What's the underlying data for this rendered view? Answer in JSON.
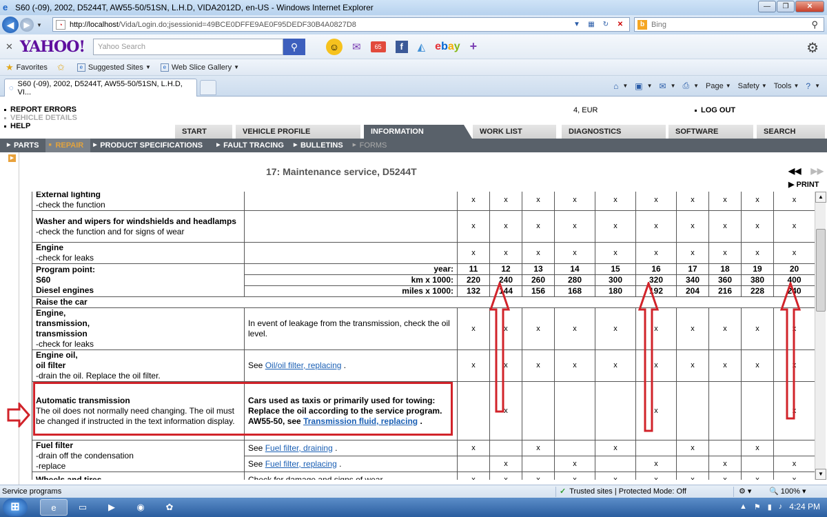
{
  "window": {
    "title": "S60 (-09), 2002, D5244T, AW55-50/51SN, L.H.D, VIDA2012D, en-US - Windows Internet Explorer"
  },
  "address": {
    "url_host": "http://localhost",
    "url_path": "/Vida/Login.do;jsessionid=49BCE0DFFE9AE0F95DEDF30B4A0827D8",
    "search_placeholder": "Bing"
  },
  "yahoo": {
    "logo": "YAHOO!",
    "search_placeholder": "Yahoo Search",
    "news_badge": "65",
    "ebay": [
      "e",
      "b",
      "a",
      "y"
    ]
  },
  "favorites": {
    "label": "Favorites",
    "items": [
      "Suggested Sites",
      "Web Slice Gallery"
    ]
  },
  "tab": {
    "label": "S60 (-09), 2002, D5244T, AW55-50/51SN, L.H.D, VI..."
  },
  "commands": [
    "Page",
    "Safety",
    "Tools"
  ],
  "app": {
    "top_menu": [
      "REPORT ERRORS",
      "VEHICLE DETAILS",
      "HELP"
    ],
    "eur": "4, EUR",
    "logout": "LOG OUT",
    "main_tabs": [
      "START",
      "VEHICLE PROFILE",
      "INFORMATION",
      "WORK LIST",
      "DIAGNOSTICS",
      "SOFTWARE",
      "SEARCH"
    ],
    "sub_tabs": [
      "PARTS",
      "REPAIR",
      "PRODUCT SPECIFICATIONS",
      "FAULT TRACING",
      "BULLETINS",
      "FORMS"
    ],
    "doc_title": "17: Maintenance service, D5244T",
    "print": "PRINT"
  },
  "table": {
    "row_exterior": {
      "title": "External lighting",
      "sub": "-check the function",
      "marks": [
        "x",
        "x",
        "x",
        "x",
        "x",
        "x",
        "x",
        "x",
        "x",
        "x"
      ]
    },
    "row_washer": {
      "title": "Washer and wipers for windshields and headlamps",
      "sub": "-check the function and for signs of wear",
      "marks": [
        "x",
        "x",
        "x",
        "x",
        "x",
        "x",
        "x",
        "x",
        "x",
        "x"
      ]
    },
    "row_engine": {
      "title": "Engine",
      "sub": "-check for leaks",
      "marks": [
        "x",
        "x",
        "x",
        "x",
        "x",
        "x",
        "x",
        "x",
        "x",
        "x"
      ]
    },
    "program": {
      "l1": "Program point:",
      "l2": "S60",
      "l3": "Diesel engines",
      "year_label": "year:",
      "km_label": "km x 1000:",
      "miles_label": "miles x 1000:",
      "years": [
        "11",
        "12",
        "13",
        "14",
        "15",
        "16",
        "17",
        "18",
        "19",
        "20"
      ],
      "km": [
        "220",
        "240",
        "260",
        "280",
        "300",
        "320",
        "340",
        "360",
        "380",
        "400"
      ],
      "miles": [
        "132",
        "144",
        "156",
        "168",
        "180",
        "192",
        "204",
        "216",
        "228",
        "240"
      ]
    },
    "raise": "Raise the car",
    "row_trans": {
      "t1": "Engine,",
      "t2": "transmission,",
      "t3": "transmission",
      "sub": "-check for leaks",
      "desc": "In event of leakage from the transmission, check the oil level.",
      "marks": [
        "x",
        "x",
        "x",
        "x",
        "x",
        "x",
        "x",
        "x",
        "x",
        "x"
      ]
    },
    "row_oil": {
      "t1": "Engine oil,",
      "t2": "oil filter",
      "sub": "-drain the oil. Replace the oil filter.",
      "see": "See",
      "link": "Oil/oil filter, replacing",
      "dot": ".",
      "marks": [
        "x",
        "x",
        "x",
        "x",
        "x",
        "x",
        "x",
        "x",
        "x",
        "x"
      ]
    },
    "row_auto": {
      "title": "Automatic transmission",
      "sub": "The oil does not normally need changing. The oil must be changed if instructed in the text information display.",
      "desc": "Cars used as taxis or primarily used for towing: Replace the oil according to the service program. AW55-50, see",
      "link": "Transmission fluid, replacing",
      "dot": ".",
      "marks": [
        "",
        "x",
        "",
        "",
        "",
        "x",
        "",
        "",
        "",
        "x"
      ]
    },
    "row_fuel": {
      "title": "Fuel filter",
      "sub1": "-drain off the condensation",
      "sub2": "-replace",
      "see": "See",
      "link1": "Fuel filter, draining",
      "link2": "Fuel filter, replacing",
      "dot": ".",
      "marks1": [
        "x",
        "",
        "x",
        "",
        "x",
        "",
        "x",
        "",
        "x",
        ""
      ],
      "marks2": [
        "",
        "x",
        "",
        "x",
        "",
        "x",
        "",
        "x",
        "",
        "x"
      ]
    },
    "row_wheels": {
      "title": "Wheels and tires",
      "desc": "Check for damage and signs of wear.",
      "marks": [
        "x",
        "x",
        "x",
        "x",
        "x",
        "x",
        "x",
        "x",
        "x",
        "x"
      ]
    }
  },
  "status": {
    "left": "Service programs",
    "trusted": "Trusted sites | Protected Mode: Off",
    "zoom": "100%"
  },
  "taskbar": {
    "time": "4:24 PM"
  },
  "colors": {
    "highlight_red": "#d1232a",
    "tab_active": "#59616a",
    "link_blue": "#1a5fb4",
    "repair_orange": "#e2a33d"
  }
}
